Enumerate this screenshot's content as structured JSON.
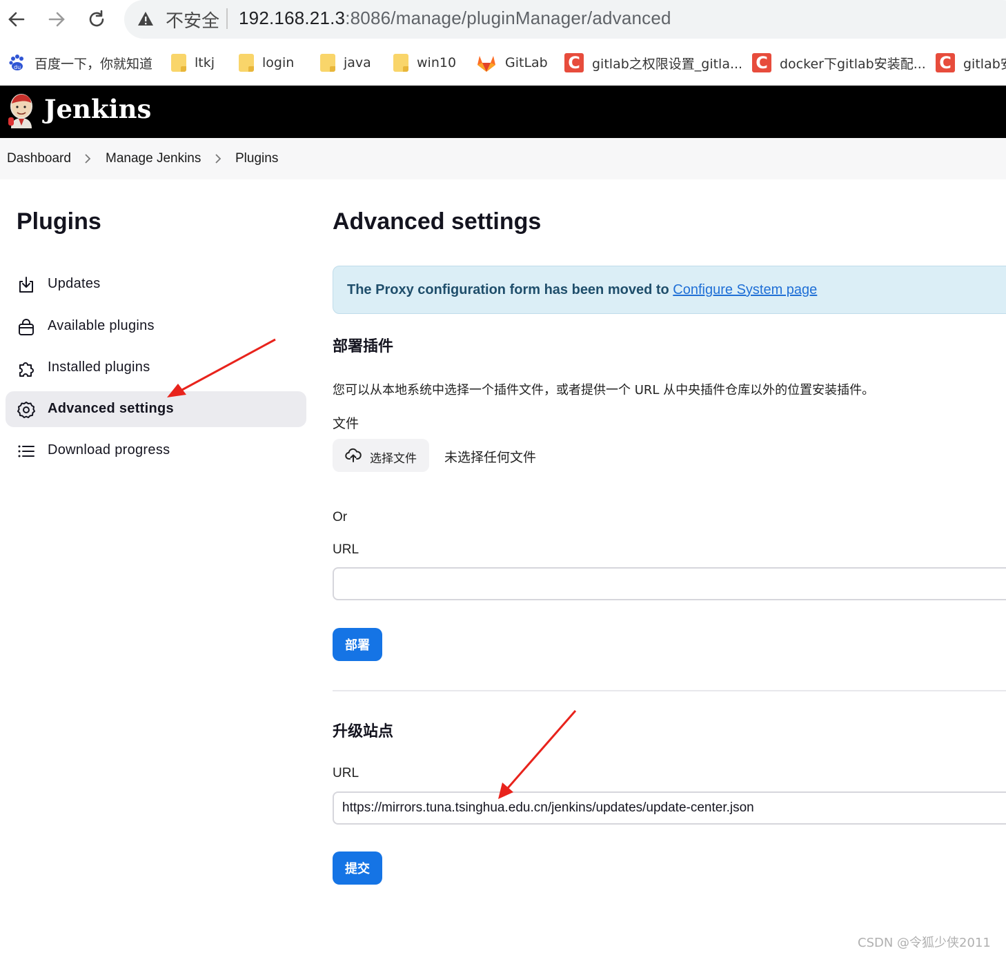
{
  "browser": {
    "security_label": "不安全",
    "url_host": "192.168.21.3",
    "url_rest": ":8086/manage/pluginManager/advanced",
    "bookmarks": [
      {
        "label": "百度一下，你就知道",
        "icon": "baidu-paw-icon"
      },
      {
        "label": "ltkj",
        "icon": "folder-icon"
      },
      {
        "label": "login",
        "icon": "folder-icon"
      },
      {
        "label": "java",
        "icon": "folder-icon"
      },
      {
        "label": "win10",
        "icon": "folder-icon"
      },
      {
        "label": "GitLab",
        "icon": "gitlab-icon"
      },
      {
        "label": "gitlab之权限设置_gitla...",
        "icon": "csdn-icon"
      },
      {
        "label": "docker下gitlab安装配...",
        "icon": "csdn-icon"
      },
      {
        "label": "gitlab安",
        "icon": "csdn-icon"
      }
    ]
  },
  "header": {
    "title": "Jenkins"
  },
  "breadcrumb": [
    "Dashboard",
    "Manage Jenkins",
    "Plugins"
  ],
  "sidebar": {
    "title": "Plugins",
    "items": [
      {
        "label": "Updates",
        "icon": "download-tray-icon"
      },
      {
        "label": "Available plugins",
        "icon": "shopping-bag-icon"
      },
      {
        "label": "Installed plugins",
        "icon": "puzzle-icon"
      },
      {
        "label": "Advanced settings",
        "icon": "gear-icon",
        "active": true
      },
      {
        "label": "Download progress",
        "icon": "list-icon"
      }
    ]
  },
  "main": {
    "title": "Advanced settings",
    "alert": {
      "text": "The Proxy configuration form has been moved to ",
      "link": "Configure System page"
    },
    "deploy": {
      "heading": "部署插件",
      "description": "您可以从本地系统中选择一个插件文件，或者提供一个 URL 从中央插件仓库以外的位置安装插件。",
      "file_label": "文件",
      "file_button": "选择文件",
      "no_file": "未选择任何文件",
      "or_label": "Or",
      "url_label": "URL",
      "url_value": "",
      "button": "部署"
    },
    "update_site": {
      "heading": "升级站点",
      "url_label": "URL",
      "url_value": "https://mirrors.tuna.tsinghua.edu.cn/jenkins/updates/update-center.json",
      "button": "提交"
    }
  },
  "watermark": "CSDN @令狐少侠2011",
  "colors": {
    "primary": "#1574e5",
    "alert_bg": "#dbeef6",
    "header_bg": "#000000",
    "annotation": "#e8231c"
  }
}
